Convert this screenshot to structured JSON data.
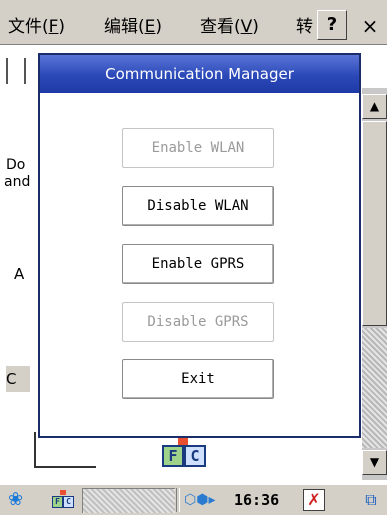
{
  "menubar": {
    "items": [
      {
        "label": "文件(",
        "accel": "F",
        "close": ")"
      },
      {
        "label": "编辑(",
        "accel": "E",
        "close": ")"
      },
      {
        "label": "查看(",
        "accel": "V",
        "close": ")"
      },
      {
        "label": "转",
        "accel": "",
        "close": ""
      }
    ],
    "help_label": "?",
    "close_label": "×"
  },
  "background_app": {
    "text_do": "Do",
    "text_and": "and",
    "text_a": "A",
    "text_c": "C"
  },
  "app_icon": {
    "letters": [
      "F",
      "C"
    ]
  },
  "scrollbar": {
    "up_glyph": "▲",
    "down_glyph": "▼"
  },
  "dialog": {
    "title": "Communication Manager",
    "buttons": [
      {
        "label": "Enable WLAN",
        "enabled": false
      },
      {
        "label": "Disable WLAN",
        "enabled": true
      },
      {
        "label": "Enable GPRS",
        "enabled": true
      },
      {
        "label": "Disable GPRS",
        "enabled": false
      },
      {
        "label": "Exit",
        "enabled": true
      }
    ]
  },
  "taskbar": {
    "start_glyph": "❀",
    "network_glyphs": "⬡⬢▸",
    "clock": "16:36",
    "tray_x_glyph": "✗",
    "tray_win_glyph": "⧉"
  },
  "colors": {
    "titlebar": "#2b48b8",
    "chrome": "#d4d0c8",
    "disabled_text": "#9a9a9a"
  }
}
